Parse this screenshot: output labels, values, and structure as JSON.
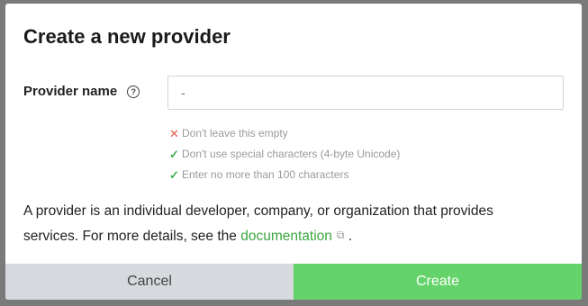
{
  "dialog": {
    "title": "Create a new provider",
    "field_label": "Provider name",
    "help_icon": "question-circle-icon",
    "input_value": "-",
    "rules": [
      {
        "status": "fail",
        "icon": "cross-icon",
        "text": "Don't leave this empty"
      },
      {
        "status": "pass",
        "icon": "check-icon",
        "text": "Don't use special characters (4-byte Unicode)"
      },
      {
        "status": "pass",
        "icon": "check-icon",
        "text": "Enter no more than 100 characters"
      }
    ],
    "description_before": "A provider is an individual developer, company, or organization that provides services. For more details, see the ",
    "description_link": "documentation",
    "description_after": ".",
    "external_link_icon": "external-link-icon",
    "cancel_label": "Cancel",
    "create_label": "Create"
  },
  "colors": {
    "accent": "#65d36b",
    "link": "#3aa83f",
    "error": "#e05b4b",
    "success": "#42b14f"
  }
}
